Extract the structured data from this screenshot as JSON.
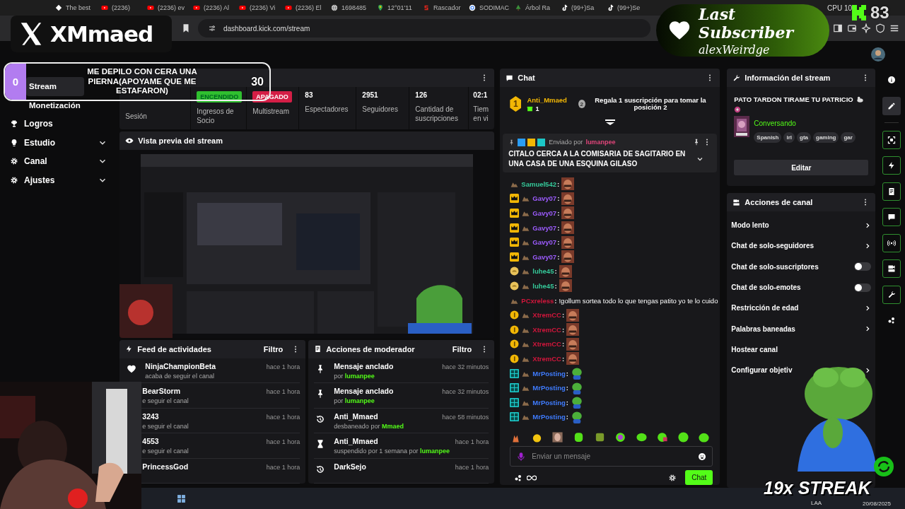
{
  "browser": {
    "tabs": [
      {
        "label": "The best"
      },
      {
        "label": "(2236)"
      },
      {
        "label": "(2236) ev"
      },
      {
        "label": "(2236) Al"
      },
      {
        "label": "(2236) Vi"
      },
      {
        "label": "(2236) El"
      },
      {
        "label": "1698485"
      },
      {
        "label": "12°01'11"
      },
      {
        "label": "Rascador"
      },
      {
        "label": "SODIMAC"
      },
      {
        "label": "Árbol Ra"
      },
      {
        "label": "(99+)Sa"
      },
      {
        "label": "(99+)Se"
      }
    ],
    "address": "dashboard.kick.com/stream",
    "cpu": "CPU 10"
  },
  "sidebar": {
    "items": [
      {
        "label": "Stream",
        "selected": true,
        "expandable": false
      },
      {
        "label": "Monetización",
        "selected": false,
        "expandable": false
      },
      {
        "label": "Logros",
        "selected": false,
        "expandable": false
      },
      {
        "label": "Estudio",
        "selected": false,
        "expandable": true
      },
      {
        "label": "Canal",
        "selected": false,
        "expandable": true
      },
      {
        "label": "Ajustes",
        "selected": false,
        "expandable": true
      }
    ]
  },
  "session": {
    "stats": [
      {
        "kind": "label",
        "label": "Sesión"
      },
      {
        "kind": "status",
        "value": "ENCENDIDO",
        "on": true,
        "label": "Ingresos de Socio"
      },
      {
        "kind": "status",
        "value": "APAGADO",
        "on": false,
        "label": "Multistream"
      },
      {
        "kind": "count",
        "value": "83",
        "label": "Espectadores"
      },
      {
        "kind": "count",
        "value": "2951",
        "label": "Seguidores"
      },
      {
        "kind": "count",
        "value": "126",
        "label": "Cantidad de suscripciones"
      },
      {
        "kind": "count",
        "value": "02:1",
        "label": "Tiem en vi"
      }
    ]
  },
  "preview": {
    "title": "Vista previa del stream"
  },
  "feed": {
    "title": "Feed de actividades",
    "filter": "Filtro",
    "items": [
      {
        "kind": "full",
        "name": "NinjaChampionBeta",
        "text": "acaba de seguir el canal",
        "time": "hace 1 hora"
      },
      {
        "kind": "partial",
        "name": "BearStorm",
        "text": "e seguir el canal",
        "time": "hace 1 hora"
      },
      {
        "kind": "partial",
        "name": "3243",
        "text": "e seguir el canal",
        "time": "hace 1 hora"
      },
      {
        "kind": "partial",
        "name": "4553",
        "text": "e seguir el canal",
        "time": "hace 1 hora"
      },
      {
        "kind": "partial",
        "name": "PrincessGod",
        "time": "hace 1 hora"
      }
    ]
  },
  "moderation": {
    "title": "Acciones de moderador",
    "filter": "Filtro",
    "items": [
      {
        "kind": "pin",
        "title": "Mensaje anclado",
        "text": "por",
        "user": "lumanpee",
        "time": "hace 32 minutos"
      },
      {
        "kind": "pin",
        "title": "Mensaje anclado",
        "text": "por",
        "user": "lumanpee",
        "time": "hace 32 minutos"
      },
      {
        "kind": "unban",
        "title": "Anti_Mmaed",
        "text": "desbaneado por",
        "user": "Mmaed",
        "time": "hace 58 minutos"
      },
      {
        "kind": "suspend",
        "title": "Anti_Mmaed",
        "text": "suspendido por 1 semana por",
        "user": "lumanpee",
        "time": "hace 1 hora"
      },
      {
        "kind": "unban",
        "title": "DarkSejo",
        "time": "hace 1 hora"
      }
    ]
  },
  "chat": {
    "title": "Chat",
    "leaders": [
      {
        "rank": "1",
        "user": "Anti_Mmaed",
        "gifts": "1"
      },
      {
        "rank": "2",
        "text": "Regala 1 suscripción para tomar la posición 2"
      }
    ],
    "pinned": {
      "label": "Enviado por",
      "user": "lumanpee",
      "text": "CITALO CERCA A LA COMISARIA DE SAGITARIO EN UNA CASA DE UNA ESQUINA GILASO"
    },
    "messages": [
      {
        "kind": "plain",
        "user": "Samuel542",
        "sep": ":",
        "color": "#35c99a",
        "emote": true
      },
      {
        "kind": "crown",
        "user": "Gavy07",
        "sep": ":",
        "color": "#9d5cff",
        "emote": true
      },
      {
        "kind": "crown",
        "user": "Gavy07",
        "sep": ":",
        "color": "#9d5cff",
        "emote": true
      },
      {
        "kind": "crown",
        "user": "Gavy07",
        "sep": ":",
        "color": "#9d5cff",
        "emote": true
      },
      {
        "kind": "crown",
        "user": "Gavy07",
        "sep": ":",
        "color": "#9d5cff",
        "emote": true
      },
      {
        "kind": "crown",
        "user": "Gavy07",
        "sep": ":",
        "color": "#9d5cff",
        "emote": true
      },
      {
        "kind": "gold",
        "user": "luhe45",
        "sep": ":",
        "color": "#35c99a",
        "emote": true
      },
      {
        "kind": "gold",
        "user": "luhe45",
        "sep": ":",
        "color": "#35c99a",
        "emote": true
      },
      {
        "kind": "plain",
        "user": "PCxreless",
        "sep": ":",
        "color": "#d4163c",
        "text": "!gollum sortea todo lo que tengas patito yo te lo cuido",
        "emote": false
      },
      {
        "kind": "coin",
        "user": "XtremCC",
        "sep": ":",
        "color": "#d4163c",
        "emote": true
      },
      {
        "kind": "coin",
        "user": "XtremCC",
        "sep": ":",
        "color": "#d4163c",
        "emote": true
      },
      {
        "kind": "coin",
        "user": "XtremCC",
        "sep": ":",
        "color": "#d4163c",
        "emote": true
      },
      {
        "kind": "coin",
        "user": "XtremCC",
        "sep": ":",
        "color": "#d4163c",
        "emote": true
      },
      {
        "kind": "og",
        "user": "MrPosting",
        "sep": ":",
        "color": "#3f7cff",
        "emote": true
      },
      {
        "kind": "og",
        "user": "MrPosting",
        "sep": ":",
        "color": "#3f7cff",
        "emote": true
      },
      {
        "kind": "og",
        "user": "MrPosting",
        "sep": ":",
        "color": "#3f7cff",
        "emote": true
      },
      {
        "kind": "og",
        "user": "MrPosting",
        "sep": ":",
        "color": "#3f7cff",
        "emote": true
      }
    ],
    "placeholder": "Enviar un mensaje",
    "send": "Chat"
  },
  "info": {
    "title": "Información del stream",
    "stream_title": "PATO TARDON TIRAME TU PATRICIO",
    "category": "Conversando",
    "tags": [
      "Spanish",
      "irl",
      "gta",
      "gaming",
      "gar"
    ],
    "edit": "Editar"
  },
  "actions": {
    "title": "Acciones de canal",
    "items": [
      {
        "kind": "arrow",
        "label": "Modo lento"
      },
      {
        "kind": "arrow",
        "label": "Chat de solo-seguidores"
      },
      {
        "kind": "toggle",
        "label": "Chat de solo-suscriptores",
        "on": false
      },
      {
        "kind": "toggle",
        "label": "Chat de solo-emotes",
        "on": false
      },
      {
        "kind": "arrow",
        "label": "Restricción de edad"
      },
      {
        "kind": "arrow",
        "label": "Palabras baneadas"
      },
      {
        "kind": "plain",
        "label": "Hostear canal"
      },
      {
        "kind": "arrow",
        "label": "Configurar objetiv"
      }
    ]
  },
  "rail": {
    "items": [
      {
        "selected": false
      },
      {
        "selected": true
      },
      {
        "selected": false
      },
      {
        "selected": false
      },
      {
        "selected": false
      },
      {
        "selected": false
      },
      {
        "selected": false
      },
      {
        "selected": false
      },
      {
        "selected": false
      },
      {
        "selected": false
      }
    ]
  },
  "overlays": {
    "handle": "XMmaed",
    "goal": {
      "current": "0",
      "text": "ME DEPILO CON CERA UNA PIERNA(APOYAME QUE ME ESTAFARON)",
      "target": "30"
    },
    "last_sub": {
      "label": "Last Subscriber",
      "name": "alexWeirdge"
    },
    "counter": "83",
    "streak": "19x STREAK"
  },
  "taskbar": {
    "lang": "LAA",
    "date": "20/08/2025"
  }
}
